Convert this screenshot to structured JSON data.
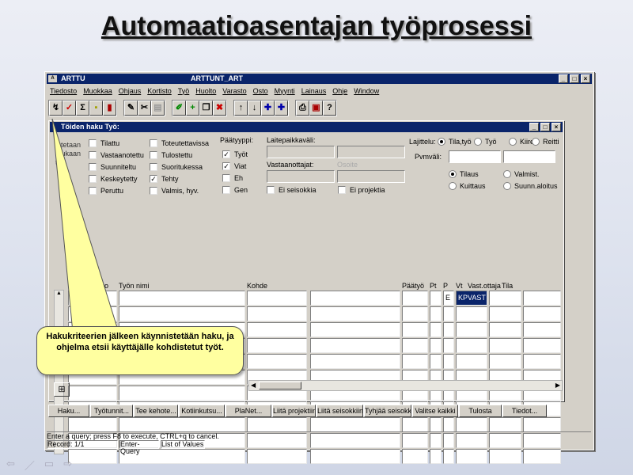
{
  "slide": {
    "title": "Automaatioasentajan työprosessi"
  },
  "app": {
    "title": "ARTTU",
    "subtitle": "ARTTUNT_ART",
    "icon": "app-icon"
  },
  "menu": [
    "Tiedosto",
    "Muokkaa",
    "Ohjaus",
    "Kortisto",
    "Työ",
    "Huolto",
    "Varasto",
    "Osto",
    "Myynti",
    "Lainaus",
    "Ohje",
    "Window"
  ],
  "form": {
    "title": "Töiden haku  Työ:",
    "partial_left": [
      "Otetaan",
      "mukaan",
      "ti"
    ],
    "status_checks": [
      {
        "label": "Tilattu",
        "checked": false
      },
      {
        "label": "Vastaanotettu",
        "checked": false
      },
      {
        "label": "Suunniteltu",
        "checked": false
      },
      {
        "label": "Keskeytetty",
        "checked": false
      },
      {
        "label": "Peruttu",
        "checked": false
      }
    ],
    "status_checks2": [
      {
        "label": "Toteutettavissa",
        "checked": false
      },
      {
        "label": "Tulostettu",
        "checked": false
      },
      {
        "label": "Suoritukessa",
        "checked": false
      },
      {
        "label": "Tehty",
        "checked": true
      },
      {
        "label": "Valmis, hyv.",
        "checked": false
      }
    ],
    "paatyyppi_label": "Päätyyppi:",
    "paatyyppi": [
      {
        "label": "Työt",
        "checked": true
      },
      {
        "label": "Viat",
        "checked": true
      },
      {
        "label": "Eh",
        "checked": false
      },
      {
        "label": "Gen",
        "checked": false
      }
    ],
    "laitepaikka_label": "Laitepaikkaväli:",
    "vastaanottaja_label": "Vastaanottajat:",
    "osoite_placeholder": "Osoite",
    "ei_seisokkia": "Ei seisokkia",
    "ei_projektia": "Ei projektia",
    "lajittelu_label": "Lajittelu:",
    "lajittelu": [
      {
        "label": "Tila,työ",
        "on": true
      },
      {
        "label": "Työ",
        "on": false
      },
      {
        "label": "Kiire",
        "on": false
      },
      {
        "label": "Reitti",
        "on": false
      }
    ],
    "pvmvali_label": "Pvmväli:",
    "date_radios": [
      {
        "label": "Tilaus",
        "on": true
      },
      {
        "label": "Valmist.",
        "on": false
      },
      {
        "label": "Kuittaus",
        "on": false
      },
      {
        "label": "Suunn.aloitus",
        "on": false
      }
    ]
  },
  "grid": {
    "headers": [
      "nro",
      "Työn nimi",
      "Kohde",
      "Päätyö",
      "Pt",
      "P",
      "Vt",
      "Vast.ottaja",
      "Tila"
    ],
    "first_row": {
      "vt": "E",
      "vast": "KPVAST"
    }
  },
  "buttons": [
    "Haku...",
    "Työtunnit...",
    "Tee kehote...",
    "Kotiinkutsu...",
    "PlaNet...",
    "Liitä projektiin",
    "Liitä seisokkiin",
    "Tyhjää seisokki",
    "Valitse kaikki",
    "Tulosta",
    "Tiedot..."
  ],
  "status": {
    "message": "Enter a query;  press F8 to execute, CTRL+q  to cancel.",
    "record": "Record: 1/1",
    "mode": "Enter-Query",
    "lov": "List of Values"
  },
  "callout": {
    "text": "Hakukriteerien jälkeen käynnistetään haku, ja ohjelma etsii käyttäjälle kohdistetut työt."
  },
  "colors": {
    "titlebar": "#0a246a",
    "face": "#d4d0c8",
    "callout": "#ffffa0",
    "selected": "#0a246a"
  }
}
